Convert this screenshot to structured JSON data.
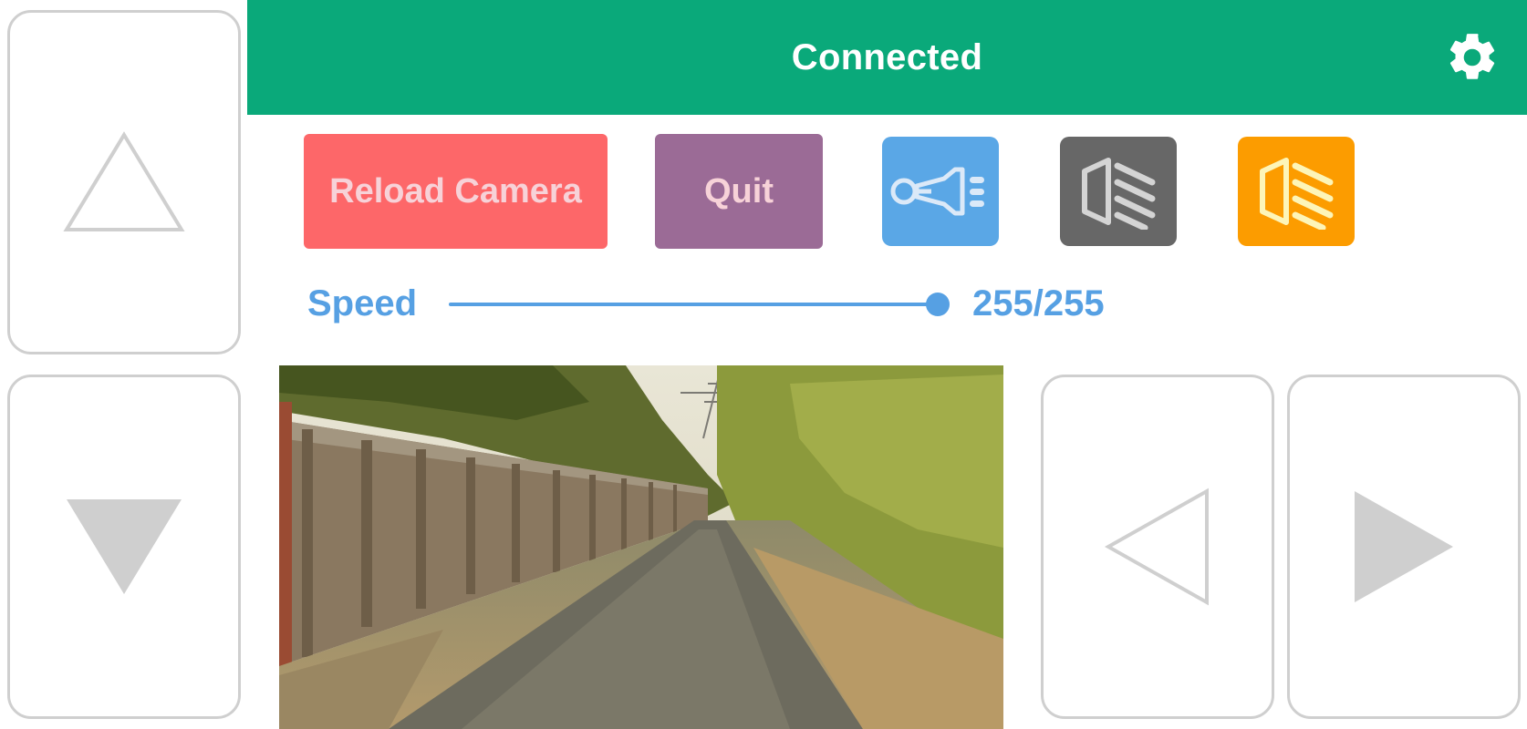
{
  "header": {
    "status": "Connected",
    "settings_icon": "gear-icon",
    "background_color": "#0aa97a"
  },
  "controls": {
    "forward_icon": "triangle-up-outline-icon",
    "reverse_icon": "triangle-down-filled-icon",
    "left_icon": "triangle-left-outline-icon",
    "right_icon": "triangle-right-filled-icon"
  },
  "actions": {
    "reload_label": "Reload Camera",
    "quit_label": "Quit",
    "horn_icon": "horn-icon",
    "light_off_icon": "headlight-off-icon",
    "light_on_icon": "headlight-on-icon"
  },
  "speed": {
    "label": "Speed",
    "value": 255,
    "max": 255,
    "display": "255/255"
  },
  "camera": {
    "feed": "camera-feed"
  },
  "colors": {
    "reload": "#fd6769",
    "quit": "#9b6b96",
    "horn": "#5aa7e6",
    "light_off": "#676767",
    "light_on": "#fc9c00",
    "accent": "#56a0e3",
    "dpad_border": "#cfcfcf"
  }
}
